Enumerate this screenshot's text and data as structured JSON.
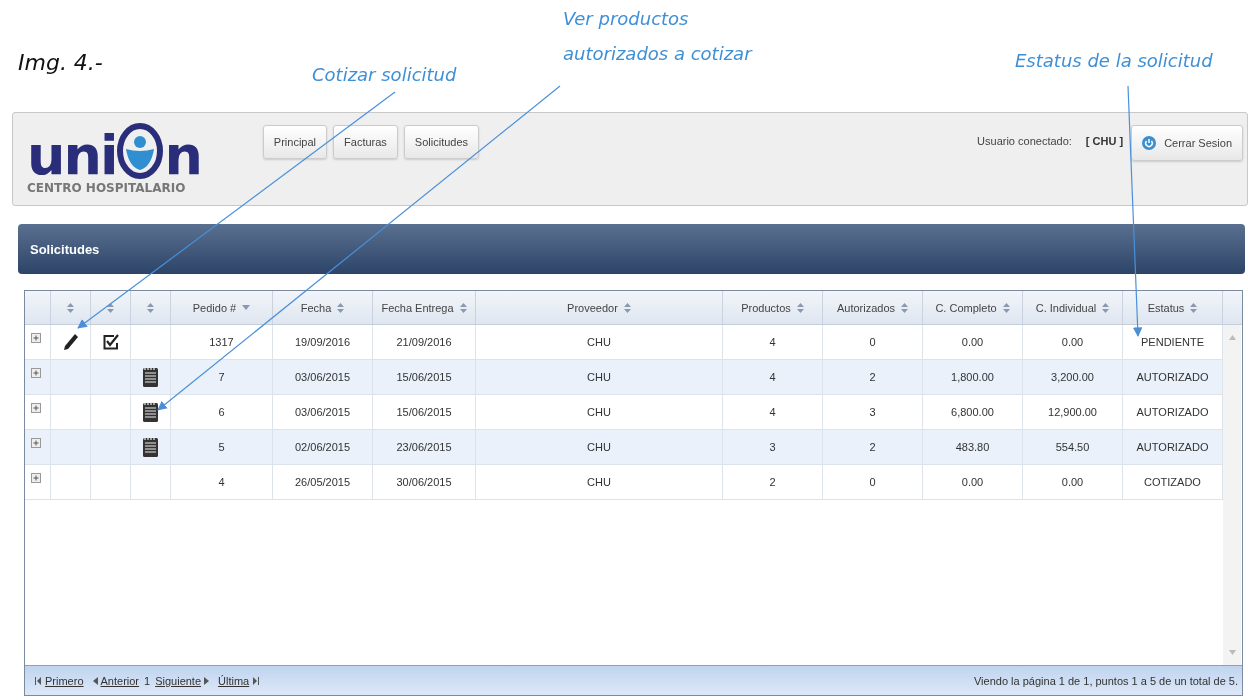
{
  "caption": "Img. 4.-",
  "callouts": [
    {
      "lines": [
        "Cotizar solicitud"
      ],
      "kind": "edit"
    },
    {
      "lines": [
        "Ver productos",
        "autorizados a cotizar"
      ],
      "kind": "products"
    },
    {
      "lines": [
        "Estatus de la solicitud"
      ],
      "kind": "status"
    }
  ],
  "logo": {
    "left": "uni",
    "right": "n",
    "subtitle": "CENTRO HOSPITALARIO"
  },
  "nav": [
    {
      "label": "Principal"
    },
    {
      "label": "Facturas"
    },
    {
      "label": "Solicitudes"
    }
  ],
  "user": {
    "label": "Usuario conectado:",
    "value": "[ CHU ]"
  },
  "logout": "Cerrar Sesion",
  "panel_title": "Solicitudes",
  "columns": [
    {
      "kind": "blank"
    },
    {
      "kind": "sortable",
      "sorted": false
    },
    {
      "kind": "sortable",
      "sorted": false
    },
    {
      "kind": "sortable",
      "sorted": false
    },
    {
      "kind": "sortable",
      "label": "Pedido #",
      "sorted": true
    },
    {
      "kind": "sortable",
      "label": "Fecha",
      "sorted": false
    },
    {
      "kind": "sortable",
      "label": "Fecha Entrega",
      "sorted": false
    },
    {
      "kind": "sortable",
      "label": "Proveedor",
      "sorted": false
    },
    {
      "kind": "sortable",
      "label": "Productos",
      "sorted": false
    },
    {
      "kind": "sortable",
      "label": "Autorizados",
      "sorted": false
    },
    {
      "kind": "sortable",
      "label": "C. Completo",
      "sorted": false
    },
    {
      "kind": "sortable",
      "label": "C. Individual",
      "sorted": false
    },
    {
      "kind": "sortable",
      "label": "Estatus",
      "sorted": false
    }
  ],
  "rows": [
    {
      "edit": true,
      "approve": true,
      "products": false,
      "cells": [
        "1317",
        "19/09/2016",
        "21/09/2016",
        "CHU",
        "4",
        "0",
        "0.00",
        "0.00",
        "PENDIENTE"
      ]
    },
    {
      "edit": false,
      "approve": false,
      "products": true,
      "cells": [
        "7",
        "03/06/2015",
        "15/06/2015",
        "CHU",
        "4",
        "2",
        "1,800.00",
        "3,200.00",
        "AUTORIZADO"
      ]
    },
    {
      "edit": false,
      "approve": false,
      "products": true,
      "cells": [
        "6",
        "03/06/2015",
        "15/06/2015",
        "CHU",
        "4",
        "3",
        "6,800.00",
        "12,900.00",
        "AUTORIZADO"
      ]
    },
    {
      "edit": false,
      "approve": false,
      "products": true,
      "cells": [
        "5",
        "02/06/2015",
        "23/06/2015",
        "CHU",
        "3",
        "2",
        "483.80",
        "554.50",
        "AUTORIZADO"
      ]
    },
    {
      "edit": false,
      "approve": false,
      "products": false,
      "cells": [
        "4",
        "26/05/2015",
        "30/06/2015",
        "CHU",
        "2",
        "0",
        "0.00",
        "0.00",
        "COTIZADO"
      ]
    }
  ],
  "pager": {
    "first": "Primero",
    "prev": "Anterior",
    "page": "1",
    "next": "Siguiente",
    "last": "Última"
  },
  "summary": "Viendo la página 1 de 1, puntos 1 a 5 de un total de 5."
}
